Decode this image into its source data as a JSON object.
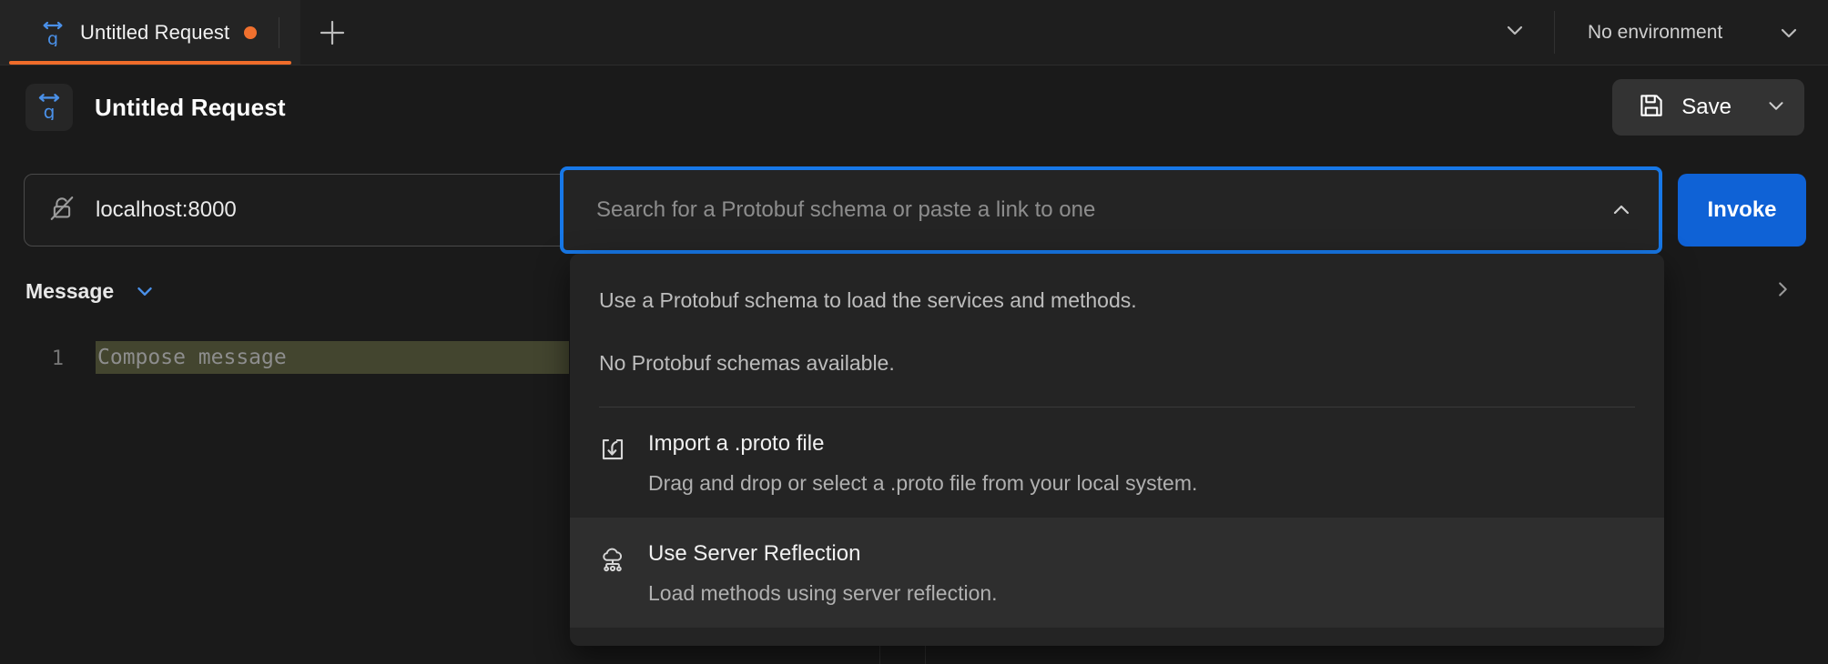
{
  "colors": {
    "accent_orange": "#ef6c2a",
    "accent_blue": "#1778e8",
    "invoke_blue": "#0f62d6",
    "grpc_icon_blue": "#4a90e8",
    "background": "#1a1a1a",
    "panel": "#242424",
    "editor_line_highlight": "#43452f"
  },
  "tabbar": {
    "tab": {
      "icon": "grpc-icon",
      "title": "Untitled Request",
      "unsaved_indicator": "unsaved-dot"
    },
    "new_tab_icon": "plus-icon",
    "tabs_caret_icon": "chevron-down-icon",
    "environment": {
      "label": "No environment",
      "caret_icon": "chevron-down-icon"
    }
  },
  "request_header": {
    "icon": "grpc-icon",
    "title": "Untitled Request",
    "save": {
      "label": "Save",
      "icon": "save-disk-icon",
      "caret_icon": "chevron-down-icon"
    }
  },
  "url_row": {
    "url_icon": "unlocked-disabled-icon",
    "url_value": "localhost:8000",
    "schema_placeholder": "Search for a Protobuf schema or paste a link to one",
    "schema_caret_icon": "chevron-up-icon",
    "invoke_label": "Invoke"
  },
  "message_panel": {
    "label": "Message",
    "caret_icon": "chevron-down-icon",
    "expand_icon": "chevron-right-icon",
    "editor": {
      "line_number": "1",
      "placeholder": "Compose message"
    }
  },
  "dropdown": {
    "hint": "Use a Protobuf schema to load the services and methods.",
    "empty_state": "No Protobuf schemas available.",
    "options": [
      {
        "icon": "import-file-icon",
        "title": "Import a .proto file",
        "subtitle": "Drag and drop or select a .proto file from your local system.",
        "highlighted": false
      },
      {
        "icon": "cloud-network-icon",
        "title": "Use Server Reflection",
        "subtitle": "Load methods using server reflection.",
        "highlighted": true
      }
    ]
  }
}
